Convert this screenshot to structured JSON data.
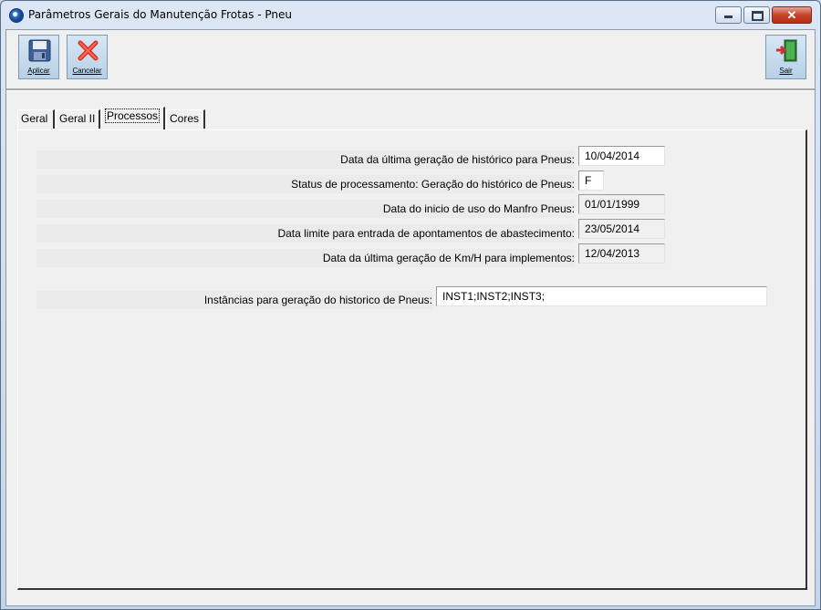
{
  "window": {
    "title": "Parâmetros Gerais do Manutenção Frotas - Pneu",
    "buttons": [
      "minimize",
      "maximize",
      "close"
    ]
  },
  "toolbar": {
    "apply_label": "Aplicar",
    "cancel_label": "Cancelar",
    "exit_label": "Sair",
    "apply_icon": "floppy-disk-icon",
    "cancel_icon": "red-x-icon",
    "exit_icon": "exit-door-icon"
  },
  "tabs": [
    {
      "label": "Geral",
      "active": false
    },
    {
      "label": "Geral II",
      "active": false
    },
    {
      "label": "Processos",
      "active": true
    },
    {
      "label": "Cores",
      "active": false
    }
  ],
  "form": {
    "fields": [
      {
        "label": "Data da última geração de histórico para Pneus:",
        "value": "10/04/2014",
        "editable": true
      },
      {
        "label": "Status de processamento: Geração do histórico de Pneus:",
        "value": "F",
        "editable": true
      },
      {
        "label": "Data do inicio de uso do Manfro Pneus:",
        "value": "01/01/1999",
        "editable": false
      },
      {
        "label": "Data limite para entrada de apontamentos de abastecimento:",
        "value": "23/05/2014",
        "editable": false
      },
      {
        "label": "Data da última geração de Km/H para implementos:",
        "value": "12/04/2013",
        "editable": false
      }
    ],
    "instances": {
      "label": "Instâncias para geração do historico de Pneus:",
      "value": "INST1;INST2;INST3;"
    }
  },
  "colors": {
    "title_bar": "#c9d8ea",
    "close_button": "#c7432b",
    "panel": "#f0f0f0"
  }
}
